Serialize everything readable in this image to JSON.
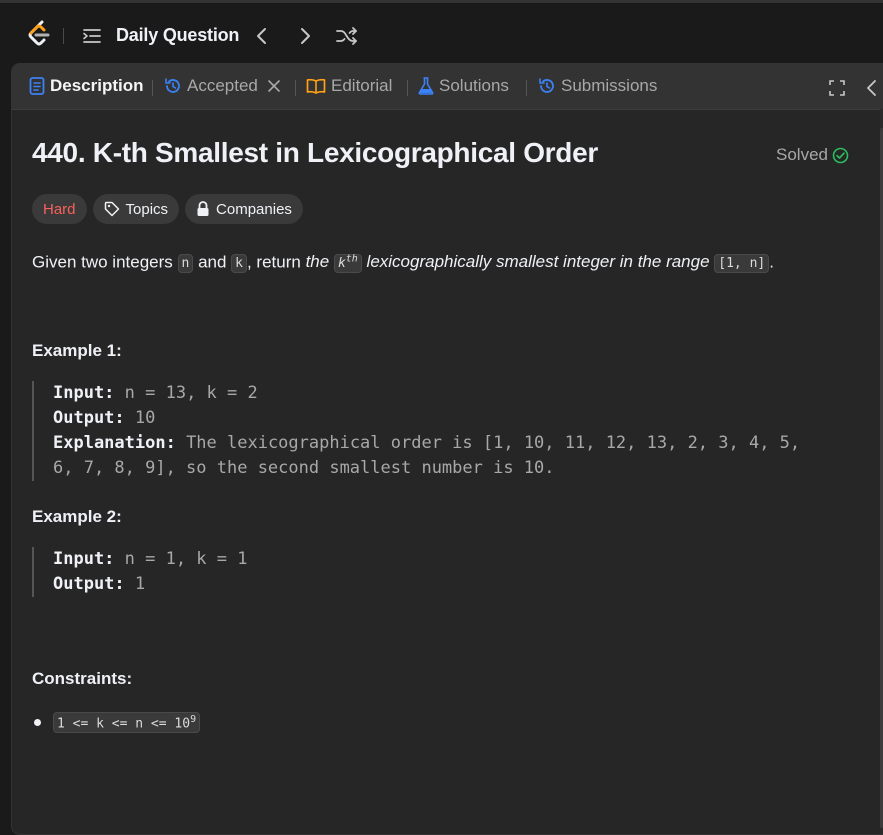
{
  "topbar": {
    "title": "Daily Question"
  },
  "tabs": {
    "description": "Description",
    "accepted": "Accepted",
    "editorial": "Editorial",
    "solutions": "Solutions",
    "submissions": "Submissions"
  },
  "problem": {
    "title": "440. K-th Smallest in Lexicographical Order",
    "status": "Solved",
    "difficulty": "Hard",
    "topics_label": "Topics",
    "companies_label": "Companies",
    "desc": {
      "p1": "Given two integers ",
      "c_n": "n",
      "p2": " and ",
      "c_k": "k",
      "p3": ", return ",
      "p4": "the ",
      "c_kth_base": "k",
      "c_kth_sup": "th",
      "p5": " lexicographically smallest integer in the range ",
      "c_range": "[1, n]",
      "p6": "."
    },
    "examples": [
      {
        "heading": "Example 1:",
        "input_label": "Input:",
        "input": " n = 13, k = 2",
        "output_label": "Output:",
        "output": " 10",
        "explanation_label": "Explanation:",
        "explanation_line1": " The lexicographical order is [1, 10, 11, 12, 13, 2, 3, 4, 5,",
        "explanation_line2": "6, 7, 8, 9], so the second smallest number is 10."
      },
      {
        "heading": "Example 2:",
        "input_label": "Input:",
        "input": " n = 1, k = 1",
        "output_label": "Output:",
        "output": " 1"
      }
    ],
    "constraints_heading": "Constraints:",
    "constraint_text": "1 <= k <= n <= 10",
    "constraint_sup": "9"
  },
  "colors": {
    "hard": "#f8615c",
    "solved_check": "#2cbb5d",
    "accent_blue": "#3b82f6",
    "editorial_amber": "#ffa116"
  }
}
